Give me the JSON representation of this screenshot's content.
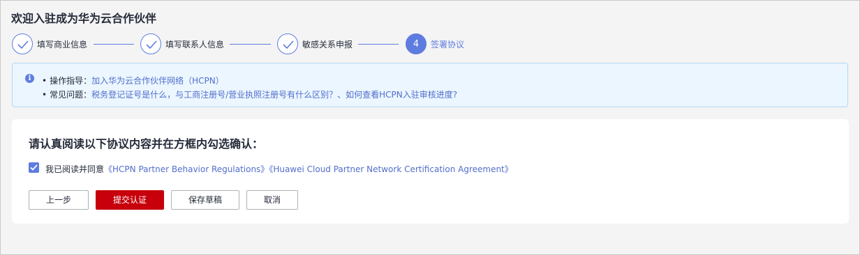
{
  "page": {
    "title": "欢迎入驻成为华为云合作伙伴"
  },
  "steps": [
    {
      "label": "填写商业信息",
      "status": "done"
    },
    {
      "label": "填写联系人信息",
      "status": "done"
    },
    {
      "label": "敏感关系申报",
      "status": "done"
    },
    {
      "number": "4",
      "label": "签署协议",
      "status": "active"
    }
  ],
  "info": {
    "guide_prefix": "操作指导：",
    "guide_link": "加入华为云合作伙伴网络（HCPN）",
    "faq_prefix": "常见问题：",
    "faq_link_1": "税务登记证号是什么，与工商注册号/营业执照注册号有什么区别？",
    "faq_sep": "、",
    "faq_link_2": "如何查看HCPN入驻审核进度?"
  },
  "agreement": {
    "heading": "请认真阅读以下协议内容并在方框内勾选确认：",
    "checked": true,
    "agree_prefix": "我已阅读并同意",
    "doc_1": "《HCPN Partner Behavior Regulations》",
    "doc_2": "《Huawei Cloud Partner Network Certification Agreement》"
  },
  "buttons": {
    "prev": "上一步",
    "submit": "提交认证",
    "save_draft": "保存草稿",
    "cancel": "取消"
  },
  "colors": {
    "accent": "#5e7ce0",
    "primary_button": "#c7000b",
    "info_bg": "#ebf6ff"
  }
}
